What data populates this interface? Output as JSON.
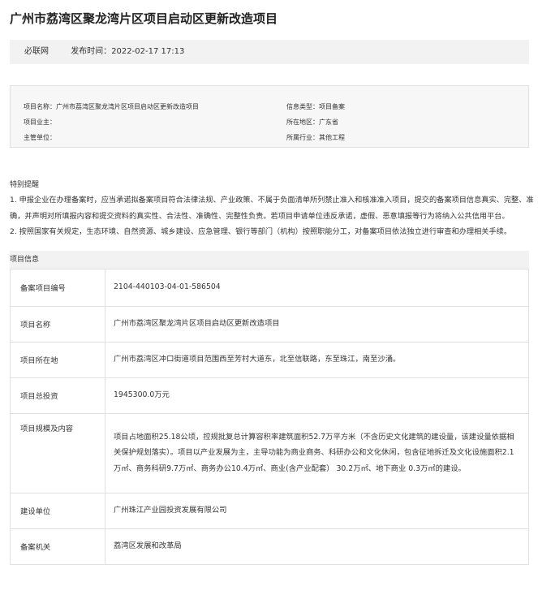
{
  "title": "广州市荔湾区聚龙湾片区项目启动区更新改造项目",
  "meta": {
    "source": "必联网",
    "publish_label": "发布时间：",
    "publish_time": "2022-02-17 17:13"
  },
  "info": {
    "left": [
      {
        "label": "项目名称：",
        "value": "广州市荔湾区聚龙湾片区项目启动区更新改造项目"
      },
      {
        "label": "项目业主：",
        "value": ""
      },
      {
        "label": "主管单位：",
        "value": ""
      }
    ],
    "right": [
      {
        "label": "信息类型：",
        "value": "项目备案"
      },
      {
        "label": "所在地区：",
        "value": "广东省"
      },
      {
        "label": "所属行业：",
        "value": "其他工程"
      }
    ]
  },
  "notice": {
    "title": "特别提醒",
    "items": [
      "1. 申报企业在办理备案时，应当承诺拟备案项目符合法律法规、产业政策、不属于负面清单所列禁止准入和核准准入项目，提交的备案项目信息真实、完整、准确，并声明对所填报内容和提交资料的真实性、合法性、准确性、完整性负责。若项目申请单位违反承诺，虚假、恶意填报等行为将纳入公共信用平台。",
      "2. 按照国家有关规定，生态环境、自然资源、城乡建设、应急管理、银行等部门（机构）按照职能分工，对备案项目依法独立进行审查和办理相关手续。"
    ]
  },
  "project": {
    "header": "项目信息",
    "rows": [
      {
        "key": "备案项目编号",
        "value": "2104-440103-04-01-586504"
      },
      {
        "key": "项目名称",
        "value": "广州市荔湾区聚龙湾片区项目启动区更新改造项目"
      },
      {
        "key": "项目所在地",
        "value": "广州市荔湾区冲口街道项目范围西至芳村大道东，北至信联路，东至珠江，南至沙涌。"
      },
      {
        "key": "项目总投资",
        "value": "1945300.0万元"
      },
      {
        "key": "项目规模及内容",
        "value": "项目占地面积25.18公顷，控规批复总计算容积率建筑面积52.7万平方米（不含历史文化建筑的建设量，该建设量依据相关保护规划落实）。项目以产业发展为主，主导功能为商业商务、科研办公和文化休闲，包含征地拆迁及文化设施面积2.1万㎡、商务科研9.7万㎡、商务办公10.4万㎡、商业(含产业配套） 30.2万㎡、地下商业 0.3万㎡的建设。"
      },
      {
        "key": "建设单位",
        "value": "广州珠江产业园投资发展有限公司"
      },
      {
        "key": "备案机关",
        "value": "荔湾区发展和改革局"
      }
    ]
  }
}
